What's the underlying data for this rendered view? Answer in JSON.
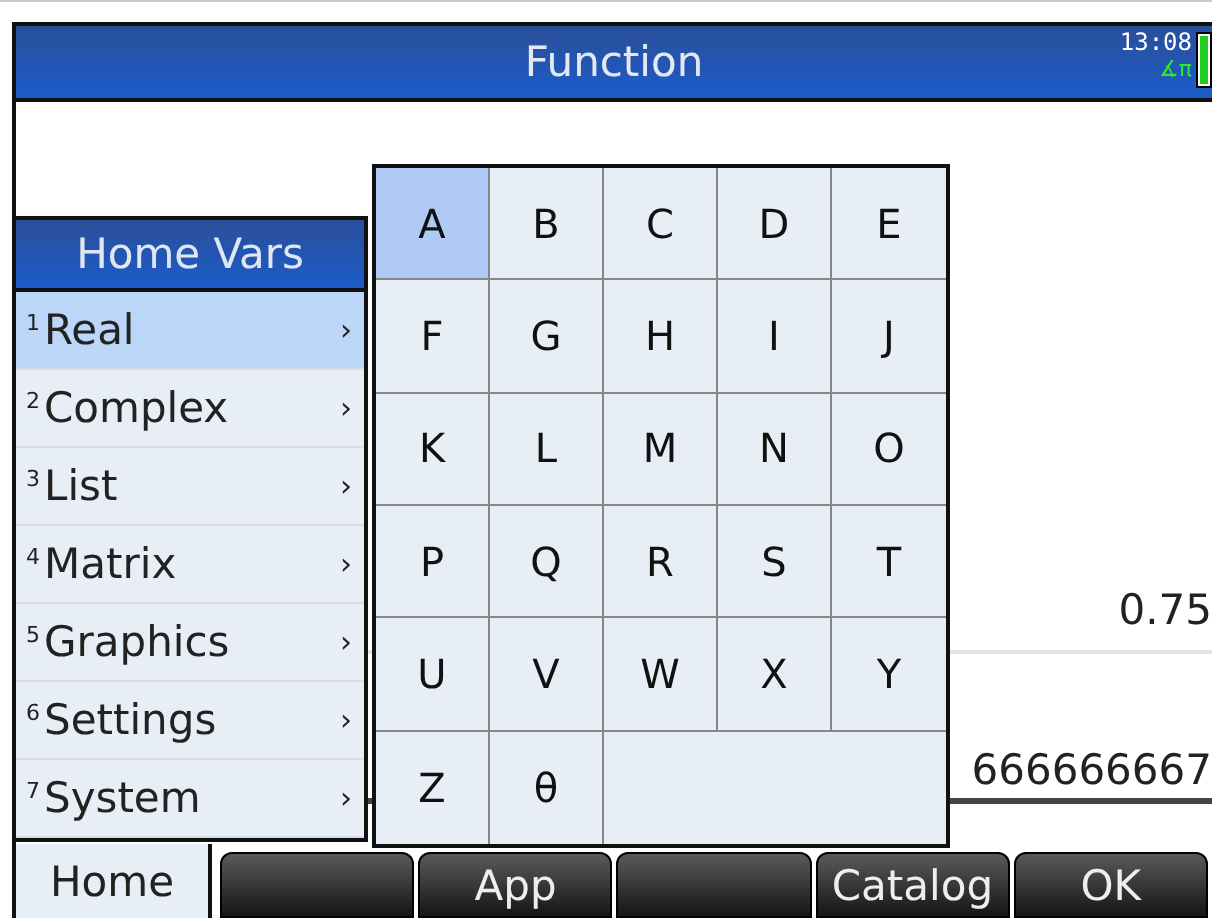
{
  "title_bar": {
    "title": "Function",
    "time": "13:08",
    "angle_mode": "∡π"
  },
  "history": [
    {
      "result": "0.75",
      "selected": false
    },
    {
      "result": "666666667",
      "selected": true
    }
  ],
  "menu": {
    "title": "Home Vars",
    "items": [
      {
        "number": "1",
        "label": "Real",
        "arrow": "›",
        "selected": true
      },
      {
        "number": "2",
        "label": "Complex",
        "arrow": "›",
        "selected": false
      },
      {
        "number": "3",
        "label": "List",
        "arrow": "›",
        "selected": false
      },
      {
        "number": "4",
        "label": "Matrix",
        "arrow": "›",
        "selected": false
      },
      {
        "number": "5",
        "label": "Graphics",
        "arrow": "›",
        "selected": false
      },
      {
        "number": "6",
        "label": "Settings",
        "arrow": "›",
        "selected": false
      },
      {
        "number": "7",
        "label": "System",
        "arrow": "›",
        "selected": false
      }
    ]
  },
  "letter_grid": [
    {
      "label": "A",
      "selected": true
    },
    {
      "label": "B",
      "selected": false
    },
    {
      "label": "C",
      "selected": false
    },
    {
      "label": "D",
      "selected": false
    },
    {
      "label": "E",
      "selected": false
    },
    {
      "label": "F",
      "selected": false
    },
    {
      "label": "G",
      "selected": false
    },
    {
      "label": "H",
      "selected": false
    },
    {
      "label": "I",
      "selected": false
    },
    {
      "label": "J",
      "selected": false
    },
    {
      "label": "K",
      "selected": false
    },
    {
      "label": "L",
      "selected": false
    },
    {
      "label": "M",
      "selected": false
    },
    {
      "label": "N",
      "selected": false
    },
    {
      "label": "O",
      "selected": false
    },
    {
      "label": "P",
      "selected": false
    },
    {
      "label": "Q",
      "selected": false
    },
    {
      "label": "R",
      "selected": false
    },
    {
      "label": "S",
      "selected": false
    },
    {
      "label": "T",
      "selected": false
    },
    {
      "label": "U",
      "selected": false
    },
    {
      "label": "V",
      "selected": false
    },
    {
      "label": "W",
      "selected": false
    },
    {
      "label": "X",
      "selected": false
    },
    {
      "label": "Y",
      "selected": false
    },
    {
      "label": "Z",
      "selected": false
    },
    {
      "label": "θ",
      "selected": false
    }
  ],
  "softkeys": [
    {
      "kind": "tab",
      "label": "Home"
    },
    {
      "kind": "blank"
    },
    {
      "kind": "button",
      "label": "App"
    },
    {
      "kind": "blank"
    },
    {
      "kind": "button",
      "label": "Catalog"
    },
    {
      "kind": "button",
      "label": "OK"
    }
  ]
}
